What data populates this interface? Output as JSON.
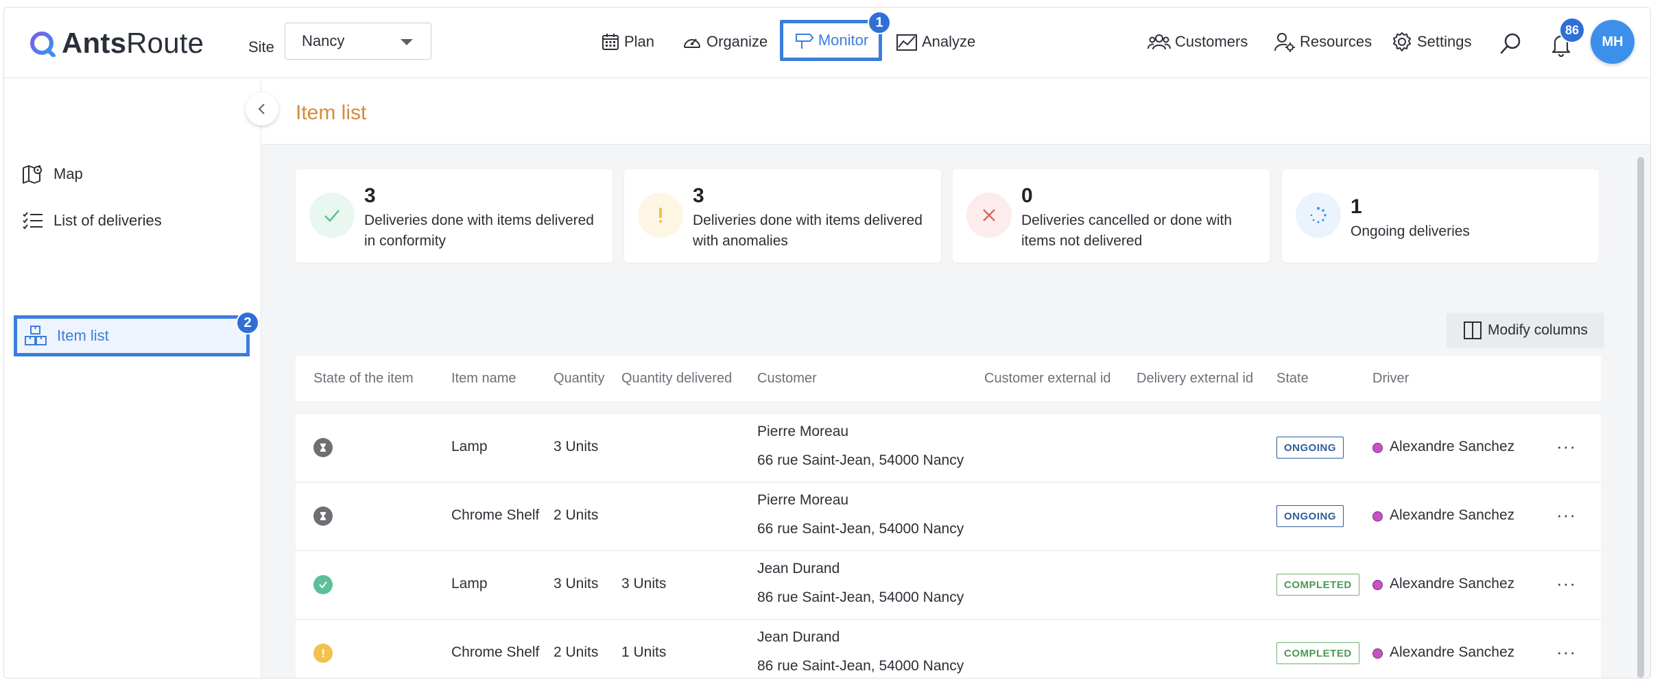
{
  "header": {
    "logo": {
      "bold": "Ants",
      "light": "Route"
    },
    "site_label": "Site",
    "site_value": "Nancy",
    "nav": {
      "plan": "Plan",
      "organize": "Organize",
      "monitor": "Monitor",
      "analyze": "Analyze",
      "customers": "Customers",
      "resources": "Resources",
      "settings": "Settings"
    },
    "step1": "1",
    "notifications": "86",
    "user_initials": "MH"
  },
  "sidebar": {
    "map": "Map",
    "list_of_deliveries": "List of deliveries",
    "item_list": "Item list",
    "step2": "2"
  },
  "page": {
    "title": "Item list"
  },
  "summary": [
    {
      "count": "3",
      "text": "Deliveries done with items delivered in conformity",
      "color": "#5bbf9a"
    },
    {
      "count": "3",
      "text": "Deliveries done with items delivered with anomalies",
      "color": "#f2c14e"
    },
    {
      "count": "0",
      "text": "Deliveries cancelled or done with items not delivered",
      "color": "#e06464"
    },
    {
      "count": "1",
      "text": "Ongoing deliveries",
      "color": "#3c8fea"
    }
  ],
  "toolbar": {
    "modify_columns": "Modify columns"
  },
  "table": {
    "columns": {
      "state": "State of the item",
      "item_name": "Item name",
      "quantity": "Quantity",
      "quantity_delivered": "Quantity delivered",
      "customer": "Customer",
      "customer_external_id": "Customer external id",
      "delivery_external_id": "Delivery external id",
      "state2": "State",
      "driver": "Driver"
    },
    "rows": [
      {
        "item_state": "ongoing",
        "item": "Lamp",
        "qty": "3 Units",
        "qty_delivered": "",
        "customer": "Pierre Moreau",
        "address": "66 rue Saint-Jean, 54000 Nancy",
        "status": "ONGOING",
        "driver": "Alexandre Sanchez"
      },
      {
        "item_state": "ongoing",
        "item": "Chrome Shelf",
        "qty": "2 Units",
        "qty_delivered": "",
        "customer": "Pierre Moreau",
        "address": "66 rue Saint-Jean, 54000 Nancy",
        "status": "ONGOING",
        "driver": "Alexandre Sanchez"
      },
      {
        "item_state": "conform",
        "item": "Lamp",
        "qty": "3 Units",
        "qty_delivered": "3 Units",
        "customer": "Jean Durand",
        "address": "86 rue Saint-Jean, 54000 Nancy",
        "status": "COMPLETED",
        "driver": "Alexandre Sanchez"
      },
      {
        "item_state": "anomaly",
        "item": "Chrome Shelf",
        "qty": "2 Units",
        "qty_delivered": "1 Units",
        "customer": "Jean Durand",
        "address": "86 rue Saint-Jean, 54000 Nancy",
        "status": "COMPLETED",
        "driver": "Alexandre Sanchez"
      }
    ],
    "more_label": "···"
  },
  "colors": {
    "accent": "#3b7ddd",
    "title": "#d88a3a",
    "driver": "#c951c7"
  }
}
